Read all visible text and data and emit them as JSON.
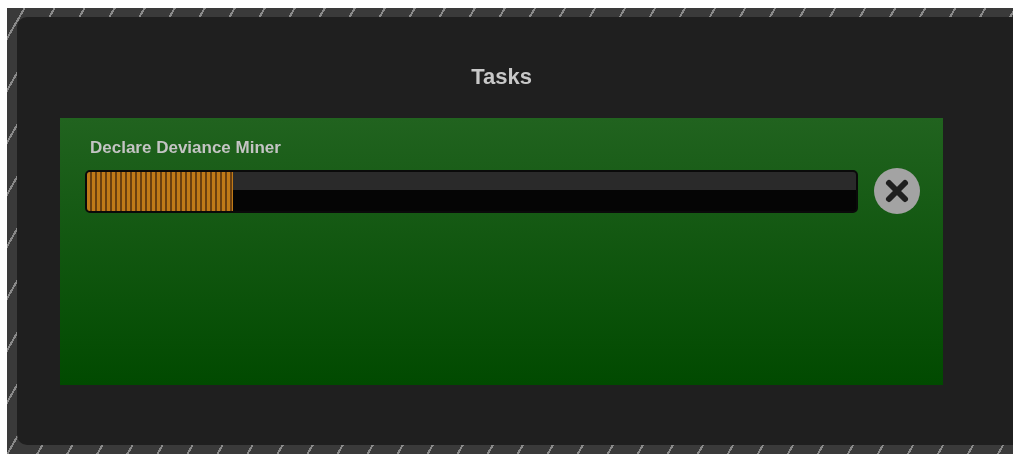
{
  "dialog": {
    "title": "Tasks"
  },
  "tasks": [
    {
      "name": "Declare Deviance Miner",
      "level": 0.19
    }
  ]
}
